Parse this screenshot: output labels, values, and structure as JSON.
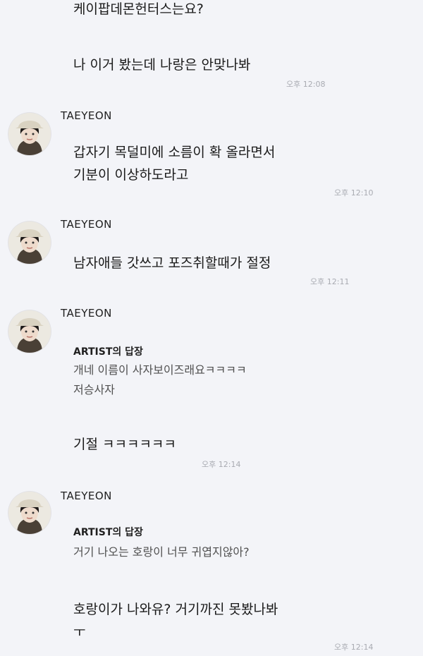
{
  "messages": {
    "top_partial": "케이팝데몬헌터스는요?",
    "m1": {
      "text": "나 이거 봤는데 나랑은 안맞나봐",
      "time": "오후 12:08"
    },
    "m2": {
      "sender": "TAEYEON",
      "lines": [
        "갑자기 목덜미에 소름이 확 올라면서",
        "기분이 이상하도라고"
      ],
      "time": "오후 12:10"
    },
    "m3": {
      "sender": "TAEYEON",
      "text": "남자애들 갓쓰고 포즈취할때가 절정",
      "time": "오후 12:11"
    },
    "m4": {
      "sender": "TAEYEON",
      "reply_title": "ARTIST의 답장",
      "reply_lines": [
        "개네 이름이 사자보이즈래요ㅋㅋㅋㅋ",
        "저승사자"
      ],
      "text": "기절 ㅋㅋㅋㅋㅋㅋ",
      "time": "오후 12:14"
    },
    "m5": {
      "sender": "TAEYEON",
      "reply_title": "ARTIST의 답장",
      "reply_text": "거기 나오는 호랑이 너무 귀엽지않아?",
      "lines": [
        "호랑이가 나와유? 거기까진 못봤나봐",
        "ㅜ"
      ],
      "time": "오후 12:14"
    }
  }
}
